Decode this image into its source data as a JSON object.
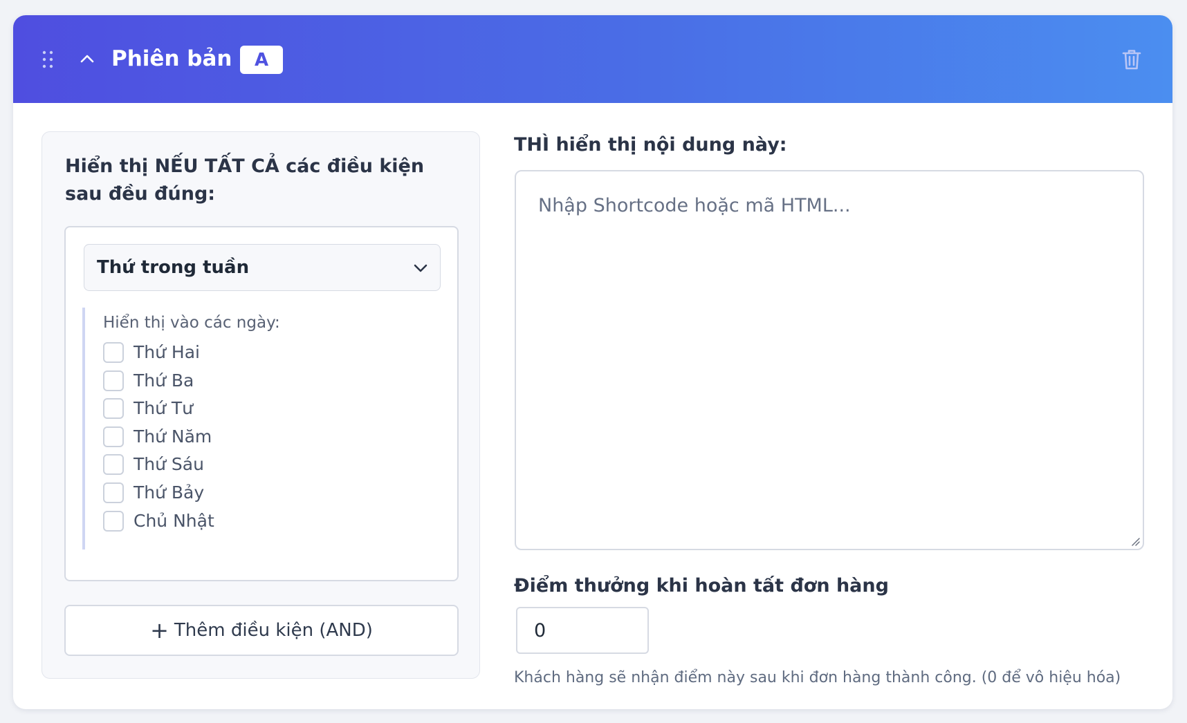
{
  "header": {
    "title": "Phiên bản",
    "badge": "A",
    "icons": {
      "drag": "drag-handle-icon",
      "collapse": "chevron-up-icon",
      "delete": "trash-icon"
    },
    "gradient_colors": [
      "#4f4ee0",
      "#4b8ef0"
    ]
  },
  "conditions": {
    "heading": "Hiển thị NẾU TẤT CẢ các điều kiện sau đều đúng:",
    "condition_type": {
      "selected": "Thứ trong tuần",
      "icon": "chevron-down-icon"
    },
    "days_label": "Hiển thị vào các ngày:",
    "days": [
      {
        "label": "Thứ Hai",
        "checked": false
      },
      {
        "label": "Thứ Ba",
        "checked": false
      },
      {
        "label": "Thứ Tư",
        "checked": false
      },
      {
        "label": "Thứ Năm",
        "checked": false
      },
      {
        "label": "Thứ Sáu",
        "checked": false
      },
      {
        "label": "Thứ Bảy",
        "checked": false
      },
      {
        "label": "Chủ Nhật",
        "checked": false
      }
    ],
    "add_button": {
      "icon": "+",
      "label": "Thêm điều kiện (AND)"
    }
  },
  "content": {
    "heading": "THÌ hiển thị nội dung này:",
    "placeholder": "Nhập Shortcode hoặc mã HTML..."
  },
  "points": {
    "label": "Điểm thưởng khi hoàn tất đơn hàng",
    "value": "0",
    "help": "Khách hàng sẽ nhận điểm này sau khi đơn hàng thành công. (0 để vô hiệu hóa)"
  }
}
